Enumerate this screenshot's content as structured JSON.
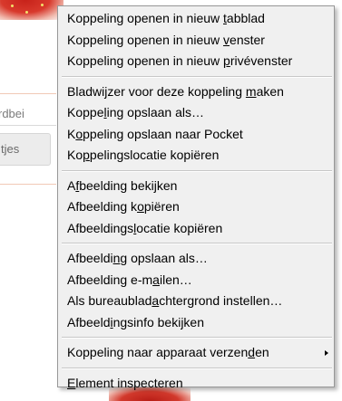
{
  "page": {
    "field_fragment": "rdbei",
    "button_fragment": "tjes"
  },
  "colors": {
    "menu_background": "#f0f0f0",
    "menu_border": "#979797",
    "separator": "#c7c7c7",
    "accent_strawberry": "#d8392c"
  },
  "menu": {
    "groups": [
      [
        {
          "pre": "Koppeling openen in nieuw ",
          "key": "t",
          "post": "abblad"
        },
        {
          "pre": "Koppeling openen in nieuw ",
          "key": "v",
          "post": "enster"
        },
        {
          "pre": "Koppeling openen in nieuw ",
          "key": "p",
          "post": "rivévenster"
        }
      ],
      [
        {
          "pre": "Bladwijzer voor deze koppeling ",
          "key": "m",
          "post": "aken"
        },
        {
          "pre": "Koppe",
          "key": "l",
          "post": "ing opslaan als…"
        },
        {
          "pre": "K",
          "key": "o",
          "post": "ppeling opslaan naar Pocket"
        },
        {
          "pre": "Ko",
          "key": "p",
          "post": "pelingslocatie kopiëren"
        }
      ],
      [
        {
          "pre": "A",
          "key": "f",
          "post": "beelding bekijken"
        },
        {
          "pre": "Afbeelding k",
          "key": "o",
          "post": "piëren"
        },
        {
          "pre": "Afbeeldings",
          "key": "l",
          "post": "ocatie kopiëren"
        }
      ],
      [
        {
          "pre": "Afbeeldi",
          "key": "n",
          "post": "g opslaan als…"
        },
        {
          "pre": "Afbeelding e-m",
          "key": "a",
          "post": "ilen…"
        },
        {
          "pre": "Als bureaublad",
          "key": "a",
          "post": "chtergrond instellen…"
        },
        {
          "pre": "Afbeeld",
          "key": "i",
          "post": "ngsinfo bekijken"
        }
      ],
      [
        {
          "pre": "Koppeling naar apparaat verzen",
          "key": "d",
          "post": "en",
          "submenu": true,
          "icon": "chevron-right-icon"
        }
      ],
      [
        {
          "pre": "",
          "key": "E",
          "post": "lement inspecteren"
        }
      ]
    ]
  }
}
